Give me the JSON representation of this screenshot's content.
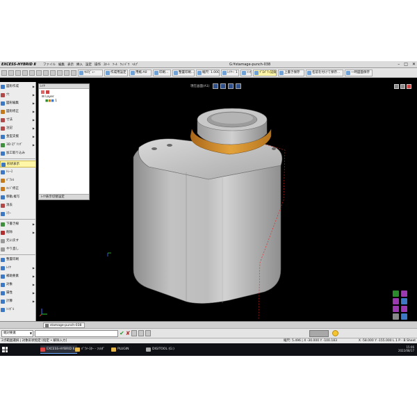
{
  "window": {
    "app_logo": "EXCESS-HYBRID Ⅱ",
    "document_title": "G:¥stamage-punch-038",
    "menus": [
      "ファイル",
      "編集",
      "表示",
      "挿入",
      "設定",
      "操作",
      "ｽﾀｰﾄ",
      "ﾂｰﾙ",
      "ｳｨﾝﾄﾞｳ",
      "ﾍﾙﾌﾟ"
    ],
    "controls": [
      "–",
      "□",
      "✕"
    ]
  },
  "toolbar": {
    "buttons": [
      {
        "label": "ﾏﾙﾁﾋﾞｭｰ",
        "highlight": false
      },
      {
        "label": "作成用設定",
        "highlight": false
      },
      {
        "label": "用紙:A0",
        "highlight": false
      },
      {
        "label": "印刷...",
        "highlight": false
      },
      {
        "label": "整置印刷...",
        "highlight": false
      },
      {
        "label": "縮尺: 1.000",
        "highlight": false
      },
      {
        "label": "ﾚｲﾔｰ: 1",
        "highlight": false
      },
      {
        "label": "ｼﾝﾎﾞﾙ",
        "highlight": false
      },
      {
        "label": "ﾌﾟﾛﾊﾟﾃｨ記録",
        "highlight": true
      },
      {
        "label": "上書き保存",
        "highlight": false
      },
      {
        "label": "名前を付けて保存...",
        "highlight": false
      },
      {
        "label": "一時図面保存",
        "highlight": false
      }
    ]
  },
  "left_panel": {
    "items": [
      {
        "label": "図形作成",
        "arrow": true,
        "color": "#3d78c4"
      },
      {
        "label": "穴",
        "arrow": true,
        "color": "#b04a4a"
      },
      {
        "label": "図形編集",
        "arrow": true,
        "color": "#3d78c4"
      },
      {
        "label": "図形修正",
        "arrow": true,
        "color": "#c47a1c"
      },
      {
        "label": "寸法",
        "arrow": true,
        "color": "#b04a4a"
      },
      {
        "label": "注記",
        "arrow": true,
        "color": "#b04a4a"
      },
      {
        "label": "金型支援",
        "arrow": true,
        "color": "#3d78c4"
      },
      {
        "label": "3D ﾓﾃﾞﾘﾝｸﾞ",
        "arrow": true,
        "color": "#3f8f3f"
      },
      {
        "label": "加工取り込み",
        "arrow": false,
        "color": "#3d78c4"
      },
      {
        "label": "形状表示",
        "arrow": false,
        "color": "#3d78c4",
        "selected": true
      },
      {
        "label": "ﾄﾚｰｽ",
        "arrow": false,
        "color": "#3d78c4"
      },
      {
        "label": "ﾊﾟﾗﾚﾙ",
        "arrow": false,
        "color": "#c47a1c"
      },
      {
        "label": "ｴｯｼﾞ修正",
        "arrow": false,
        "color": "#c47a1c"
      },
      {
        "label": "移動,複写",
        "arrow": false,
        "color": "#3d78c4"
      },
      {
        "label": "消去",
        "arrow": false,
        "color": "#b04a4a"
      },
      {
        "label": "ﾐﾗｰ",
        "arrow": false,
        "color": "#3d78c4"
      },
      {
        "label": "下書き線",
        "arrow": true,
        "color": "#3f8f3f"
      },
      {
        "label": "削除",
        "arrow": true,
        "color": "#b03030"
      },
      {
        "label": "元に戻す",
        "arrow": false,
        "color": "#9a9a9a"
      },
      {
        "label": "やり直し",
        "arrow": false,
        "color": "#9a9a9a"
      },
      {
        "label": "整置印刷",
        "arrow": false,
        "color": "#3d78c4"
      },
      {
        "label": "ﾚｲﾔ",
        "arrow": true,
        "color": "#3d78c4"
      },
      {
        "label": "補助要素",
        "arrow": true,
        "color": "#3d78c4"
      },
      {
        "label": "対象",
        "arrow": true,
        "color": "#3d78c4"
      },
      {
        "label": "属性",
        "arrow": true,
        "color": "#3d78c4"
      },
      {
        "label": "計算",
        "arrow": true,
        "color": "#3d78c4"
      },
      {
        "label": "ｼﾝﾎﾞﾙ",
        "arrow": false,
        "color": "#3d78c4"
      }
    ]
  },
  "layer_panel": {
    "title": "ﾚｲﾔ",
    "tree": [
      "Layer",
      "1"
    ],
    "footer": "ﾚｲﾔ表示切替設定"
  },
  "viewport": {
    "view_label": "現在画面(A1)",
    "background": "#000000",
    "body_color": "#b8b8b8",
    "accent_color": "#d3922a"
  },
  "tabs": [
    {
      "label": "stamage-punch-038"
    }
  ],
  "command": {
    "mode": "端対要素"
  },
  "status": {
    "left": "2点範囲選択 | 対象形状指定 [指定 • 解除入力]",
    "middle": "縮尺: 5.496 | X -30.000 Y -100.183",
    "right": "X -58.000 Y -155.000  L 1  P - B Sheet"
  },
  "taskbar": {
    "items": [
      {
        "label": "EXCESS-HYBRID Ⅱ...",
        "color": "#d44",
        "active": true
      },
      {
        "label": "ﾊﾟﾗﾒｰｽﾀｰ - ﾌｫﾙﾀﾞ",
        "color": "#e6b84a",
        "active": false
      },
      {
        "label": "PLUGIN",
        "color": "#e6b84a",
        "active": false
      },
      {
        "label": "DIGITOOL (G:)",
        "color": "#aaa",
        "active": false
      }
    ],
    "time": "15:06",
    "date": "2022/08/17"
  }
}
